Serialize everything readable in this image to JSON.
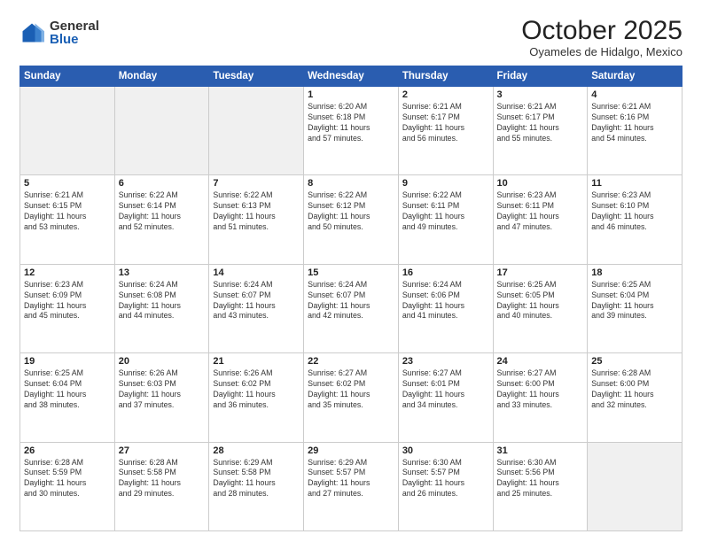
{
  "header": {
    "logo": {
      "general": "General",
      "blue": "Blue"
    },
    "title": "October 2025",
    "location": "Oyameles de Hidalgo, Mexico"
  },
  "weekdays": [
    "Sunday",
    "Monday",
    "Tuesday",
    "Wednesday",
    "Thursday",
    "Friday",
    "Saturday"
  ],
  "weeks": [
    [
      {
        "day": "",
        "empty": true
      },
      {
        "day": "",
        "empty": true
      },
      {
        "day": "",
        "empty": true
      },
      {
        "day": "1",
        "info": "Sunrise: 6:20 AM\nSunset: 6:18 PM\nDaylight: 11 hours\nand 57 minutes."
      },
      {
        "day": "2",
        "info": "Sunrise: 6:21 AM\nSunset: 6:17 PM\nDaylight: 11 hours\nand 56 minutes."
      },
      {
        "day": "3",
        "info": "Sunrise: 6:21 AM\nSunset: 6:17 PM\nDaylight: 11 hours\nand 55 minutes."
      },
      {
        "day": "4",
        "info": "Sunrise: 6:21 AM\nSunset: 6:16 PM\nDaylight: 11 hours\nand 54 minutes."
      }
    ],
    [
      {
        "day": "5",
        "info": "Sunrise: 6:21 AM\nSunset: 6:15 PM\nDaylight: 11 hours\nand 53 minutes."
      },
      {
        "day": "6",
        "info": "Sunrise: 6:22 AM\nSunset: 6:14 PM\nDaylight: 11 hours\nand 52 minutes."
      },
      {
        "day": "7",
        "info": "Sunrise: 6:22 AM\nSunset: 6:13 PM\nDaylight: 11 hours\nand 51 minutes."
      },
      {
        "day": "8",
        "info": "Sunrise: 6:22 AM\nSunset: 6:12 PM\nDaylight: 11 hours\nand 50 minutes."
      },
      {
        "day": "9",
        "info": "Sunrise: 6:22 AM\nSunset: 6:11 PM\nDaylight: 11 hours\nand 49 minutes."
      },
      {
        "day": "10",
        "info": "Sunrise: 6:23 AM\nSunset: 6:11 PM\nDaylight: 11 hours\nand 47 minutes."
      },
      {
        "day": "11",
        "info": "Sunrise: 6:23 AM\nSunset: 6:10 PM\nDaylight: 11 hours\nand 46 minutes."
      }
    ],
    [
      {
        "day": "12",
        "info": "Sunrise: 6:23 AM\nSunset: 6:09 PM\nDaylight: 11 hours\nand 45 minutes."
      },
      {
        "day": "13",
        "info": "Sunrise: 6:24 AM\nSunset: 6:08 PM\nDaylight: 11 hours\nand 44 minutes."
      },
      {
        "day": "14",
        "info": "Sunrise: 6:24 AM\nSunset: 6:07 PM\nDaylight: 11 hours\nand 43 minutes."
      },
      {
        "day": "15",
        "info": "Sunrise: 6:24 AM\nSunset: 6:07 PM\nDaylight: 11 hours\nand 42 minutes."
      },
      {
        "day": "16",
        "info": "Sunrise: 6:24 AM\nSunset: 6:06 PM\nDaylight: 11 hours\nand 41 minutes."
      },
      {
        "day": "17",
        "info": "Sunrise: 6:25 AM\nSunset: 6:05 PM\nDaylight: 11 hours\nand 40 minutes."
      },
      {
        "day": "18",
        "info": "Sunrise: 6:25 AM\nSunset: 6:04 PM\nDaylight: 11 hours\nand 39 minutes."
      }
    ],
    [
      {
        "day": "19",
        "info": "Sunrise: 6:25 AM\nSunset: 6:04 PM\nDaylight: 11 hours\nand 38 minutes."
      },
      {
        "day": "20",
        "info": "Sunrise: 6:26 AM\nSunset: 6:03 PM\nDaylight: 11 hours\nand 37 minutes."
      },
      {
        "day": "21",
        "info": "Sunrise: 6:26 AM\nSunset: 6:02 PM\nDaylight: 11 hours\nand 36 minutes."
      },
      {
        "day": "22",
        "info": "Sunrise: 6:27 AM\nSunset: 6:02 PM\nDaylight: 11 hours\nand 35 minutes."
      },
      {
        "day": "23",
        "info": "Sunrise: 6:27 AM\nSunset: 6:01 PM\nDaylight: 11 hours\nand 34 minutes."
      },
      {
        "day": "24",
        "info": "Sunrise: 6:27 AM\nSunset: 6:00 PM\nDaylight: 11 hours\nand 33 minutes."
      },
      {
        "day": "25",
        "info": "Sunrise: 6:28 AM\nSunset: 6:00 PM\nDaylight: 11 hours\nand 32 minutes."
      }
    ],
    [
      {
        "day": "26",
        "info": "Sunrise: 6:28 AM\nSunset: 5:59 PM\nDaylight: 11 hours\nand 30 minutes."
      },
      {
        "day": "27",
        "info": "Sunrise: 6:28 AM\nSunset: 5:58 PM\nDaylight: 11 hours\nand 29 minutes."
      },
      {
        "day": "28",
        "info": "Sunrise: 6:29 AM\nSunset: 5:58 PM\nDaylight: 11 hours\nand 28 minutes."
      },
      {
        "day": "29",
        "info": "Sunrise: 6:29 AM\nSunset: 5:57 PM\nDaylight: 11 hours\nand 27 minutes."
      },
      {
        "day": "30",
        "info": "Sunrise: 6:30 AM\nSunset: 5:57 PM\nDaylight: 11 hours\nand 26 minutes."
      },
      {
        "day": "31",
        "info": "Sunrise: 6:30 AM\nSunset: 5:56 PM\nDaylight: 11 hours\nand 25 minutes."
      },
      {
        "day": "",
        "empty": true
      }
    ]
  ]
}
